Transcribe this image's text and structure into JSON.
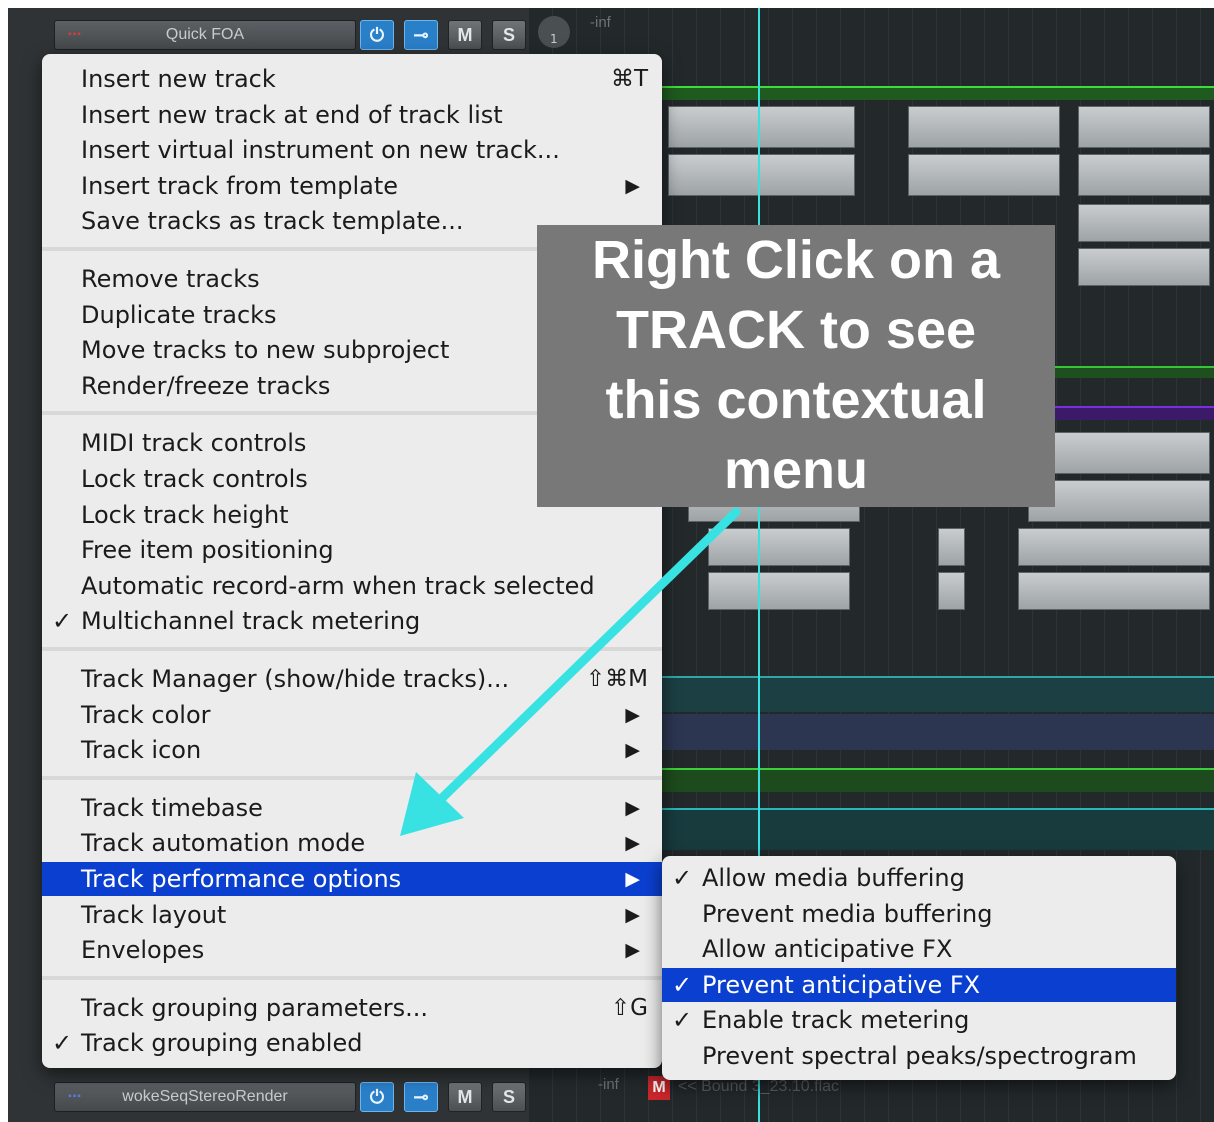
{
  "tracks": {
    "top": {
      "name": "Quick FOA",
      "meter": "-inf",
      "record_slot": "1"
    },
    "bottom": {
      "name": "wokeSeqStereoRender",
      "meter": "-inf",
      "item_label": "<< Bound 3_23.10.flac"
    },
    "buttons": {
      "mute": "M",
      "solo": "S",
      "media_badge": "M"
    }
  },
  "context_menu": {
    "groups": [
      [
        {
          "label": "Insert new track",
          "shortcut": "⌘T"
        },
        {
          "label": "Insert new track at end of track list"
        },
        {
          "label": "Insert virtual instrument on new track..."
        },
        {
          "label": "Insert track from template",
          "submenu": true
        },
        {
          "label": "Save tracks as track template..."
        }
      ],
      [
        {
          "label": "Remove tracks"
        },
        {
          "label": "Duplicate tracks"
        },
        {
          "label": "Move tracks to new subproject"
        },
        {
          "label": "Render/freeze tracks"
        }
      ],
      [
        {
          "label": "MIDI track controls"
        },
        {
          "label": "Lock track controls"
        },
        {
          "label": "Lock track height"
        },
        {
          "label": "Free item positioning"
        },
        {
          "label": "Automatic record-arm when track selected"
        },
        {
          "label": "Multichannel track metering",
          "checked": true
        }
      ],
      [
        {
          "label": "Track Manager (show/hide tracks)...",
          "shortcut": "⇧⌘M"
        },
        {
          "label": "Track color",
          "submenu": true
        },
        {
          "label": "Track icon",
          "submenu": true
        }
      ],
      [
        {
          "label": "Track timebase",
          "submenu": true
        },
        {
          "label": "Track automation mode",
          "submenu": true
        },
        {
          "label": "Track performance options",
          "submenu": true,
          "highlighted": true
        },
        {
          "label": "Track layout",
          "submenu": true
        },
        {
          "label": "Envelopes",
          "submenu": true
        }
      ],
      [
        {
          "label": "Track grouping parameters...",
          "shortcut": "⇧G"
        },
        {
          "label": "Track grouping enabled",
          "checked": true
        }
      ]
    ]
  },
  "submenu": {
    "items": [
      {
        "label": "Allow media buffering",
        "checked": true
      },
      {
        "label": "Prevent media buffering",
        "checked": false
      },
      {
        "label": "Allow anticipative FX",
        "checked": false
      },
      {
        "label": "Prevent anticipative FX",
        "checked": true,
        "highlighted": true
      },
      {
        "label": "Enable track metering",
        "checked": true
      },
      {
        "label": "Prevent spectral peaks/spectrogram",
        "checked": false
      }
    ]
  },
  "callout": {
    "lines": [
      "Right Click on a",
      "TRACK to see",
      "this contextual",
      "menu"
    ]
  },
  "symbols": {
    "check": "✓",
    "submenu_arrow": "▶",
    "rec_dots": "▪▪▪"
  },
  "colors": {
    "menu_bg": "#ececec",
    "highlight": "#0b3fcf",
    "callout_bg": "#787878",
    "arrow": "#39e2e2",
    "track_button_blue": "#2a7fc9"
  }
}
